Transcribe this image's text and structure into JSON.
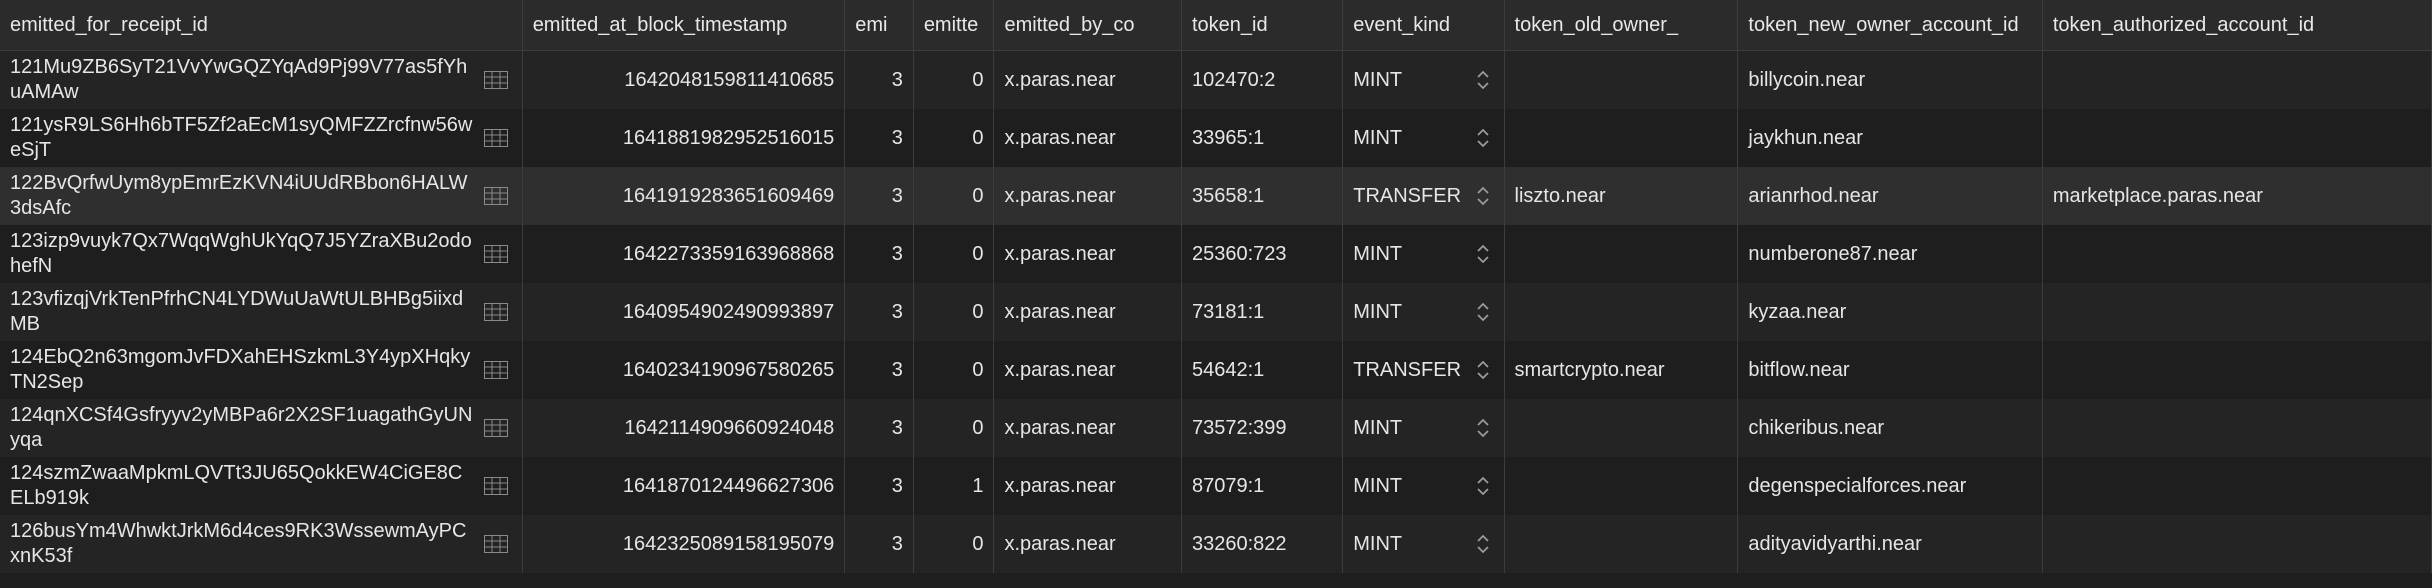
{
  "columns": [
    "emitted_for_receipt_id",
    "emitted_at_block_timestamp",
    "emi",
    "emitte",
    "emitted_by_co",
    "token_id",
    "event_kind",
    "token_old_owner_",
    "token_new_owner_account_id",
    "token_authorized_account_id"
  ],
  "icons": {
    "receipt_link": "table-grid-icon",
    "kind_select": "up-down-chevron-icon"
  },
  "rows": [
    {
      "receipt": "121Mu9ZB6SyT21VvYwGQZYqAd9Pj99V77as5fYhuAMAw",
      "ts": "1642048159811410685",
      "c3": "3",
      "c4": "0",
      "by": "x.paras.near",
      "token": "102470:2",
      "kind": "MINT",
      "old": "",
      "new": "billycoin.near",
      "auth": ""
    },
    {
      "receipt": "121ysR9LS6Hh6bTF5Zf2aEcM1syQMFZZrcfnw56weSjT",
      "ts": "1641881982952516015",
      "c3": "3",
      "c4": "0",
      "by": "x.paras.near",
      "token": "33965:1",
      "kind": "MINT",
      "old": "",
      "new": "jaykhun.near",
      "auth": ""
    },
    {
      "receipt": "122BvQrfwUym8ypEmrEzKVN4iUUdRBbon6HALW3dsAfc",
      "ts": "1641919283651609469",
      "c3": "3",
      "c4": "0",
      "by": "x.paras.near",
      "token": "35658:1",
      "kind": "TRANSFER",
      "old": "liszto.near",
      "new": "arianrhod.near",
      "auth": "marketplace.paras.near"
    },
    {
      "receipt": "123izp9vuyk7Qx7WqqWghUkYqQ7J5YZraXBu2odohefN",
      "ts": "1642273359163968868",
      "c3": "3",
      "c4": "0",
      "by": "x.paras.near",
      "token": "25360:723",
      "kind": "MINT",
      "old": "",
      "new": "numberone87.near",
      "auth": ""
    },
    {
      "receipt": "123vfizqjVrkTenPfrhCN4LYDWuUaWtULBHBg5iixdMB",
      "ts": "1640954902490993897",
      "c3": "3",
      "c4": "0",
      "by": "x.paras.near",
      "token": "73181:1",
      "kind": "MINT",
      "old": "",
      "new": "kyzaa.near",
      "auth": ""
    },
    {
      "receipt": "124EbQ2n63mgomJvFDXahEHSzkmL3Y4ypXHqkyTN2Sep",
      "ts": "1640234190967580265",
      "c3": "3",
      "c4": "0",
      "by": "x.paras.near",
      "token": "54642:1",
      "kind": "TRANSFER",
      "old": "smartcrypto.near",
      "new": "bitflow.near",
      "auth": ""
    },
    {
      "receipt": "124qnXCSf4Gsfryyv2yMBPa6r2X2SF1uagathGyUNyqa",
      "ts": "1642114909660924048",
      "c3": "3",
      "c4": "0",
      "by": "x.paras.near",
      "token": "73572:399",
      "kind": "MINT",
      "old": "",
      "new": "chikeribus.near",
      "auth": ""
    },
    {
      "receipt": "124szmZwaaMpkmLQVTt3JU65QokkEW4CiGE8CELb919k",
      "ts": "1641870124496627306",
      "c3": "3",
      "c4": "1",
      "by": "x.paras.near",
      "token": "87079:1",
      "kind": "MINT",
      "old": "",
      "new": "degenspecialforces.near",
      "auth": ""
    },
    {
      "receipt": "126busYm4WhwktJrkM6d4ces9RK3WssewmAyPCxnK53f",
      "ts": "1642325089158195079",
      "c3": "3",
      "c4": "0",
      "by": "x.paras.near",
      "token": "33260:822",
      "kind": "MINT",
      "old": "",
      "new": "adityavidyarthi.near",
      "auth": ""
    }
  ]
}
